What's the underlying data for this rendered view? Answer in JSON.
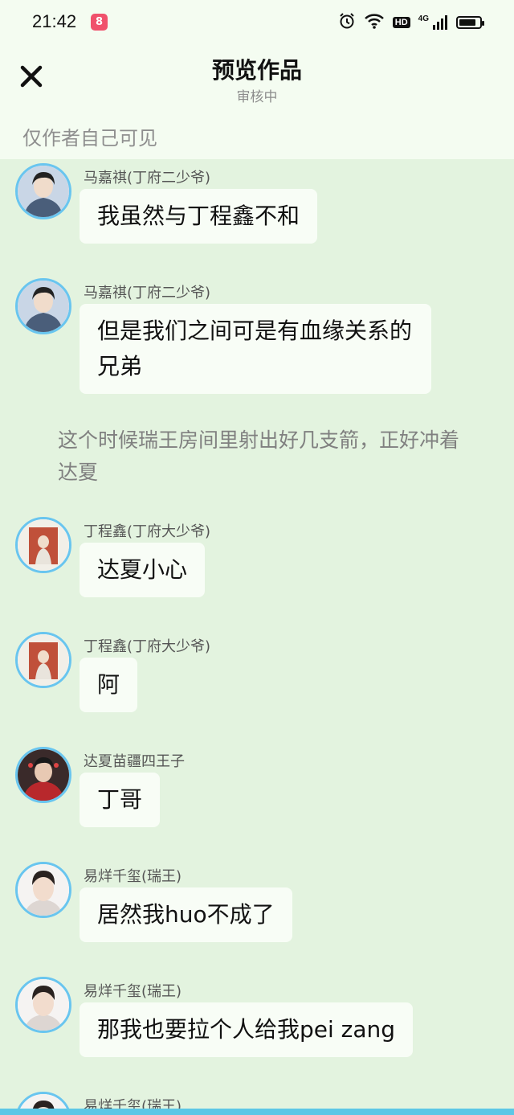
{
  "status_bar": {
    "time": "21:42",
    "app_badge": "8",
    "hd_label": "HD",
    "network_label": "4G",
    "battery_level": 0.85,
    "icons": [
      "alarm-icon",
      "wifi-icon",
      "hd-icon",
      "signal-4g-icon",
      "battery-icon"
    ]
  },
  "header": {
    "title": "预览作品",
    "status": "审核中",
    "visibility_note": "仅作者自己可见"
  },
  "colors": {
    "background": "#e3f3df",
    "header_bg": "#f4fcf1",
    "bubble_bg": "#f8fdf6",
    "avatar_ring": "#69c5ef",
    "bottom_accent": "#5cc7e6"
  },
  "messages": [
    {
      "kind": "chat",
      "speaker": "马嘉祺(丁府二少爷)",
      "text": "我虽然与丁程鑫不和",
      "avatar": "avatar-majiaqi"
    },
    {
      "kind": "chat",
      "speaker": "马嘉祺(丁府二少爷)",
      "text": "但是我们之间可是有血缘关系的兄弟",
      "avatar": "avatar-majiaqi"
    },
    {
      "kind": "narration",
      "text": "这个时候瑞王房间里射出好几支箭，正好冲着达夏"
    },
    {
      "kind": "chat",
      "speaker": "丁程鑫(丁府大少爷)",
      "text": "达夏小心",
      "avatar": "avatar-dingchengxin"
    },
    {
      "kind": "chat",
      "speaker": "丁程鑫(丁府大少爷)",
      "text": "阿",
      "avatar": "avatar-dingchengxin"
    },
    {
      "kind": "chat",
      "speaker": "达夏苗疆四王子",
      "text": "丁哥",
      "avatar": "avatar-daxia"
    },
    {
      "kind": "chat",
      "speaker": "易烊千玺(瑞王)",
      "text": "居然我huo不成了",
      "avatar": "avatar-yiyangqianxi"
    },
    {
      "kind": "chat",
      "speaker": "易烊千玺(瑞王)",
      "text": "那我也要拉个人给我pei zang",
      "avatar": "avatar-yiyangqianxi"
    },
    {
      "kind": "chat",
      "speaker": "易烊千玺(瑞王)",
      "text": "",
      "avatar": "avatar-yiyangqianxi"
    }
  ]
}
